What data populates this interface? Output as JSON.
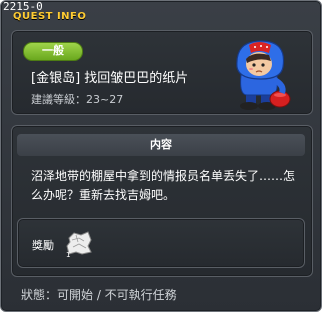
{
  "window": {
    "quest_id": "2215-0",
    "title": "QUEST INFO"
  },
  "quest": {
    "category": "一般",
    "name": "[金银岛] 找回皱巴巴的纸片",
    "level": "建議等級：23~27",
    "npc_icon": "hooded-boy-npc-icon"
  },
  "content": {
    "header": "内容",
    "description": "沼泽地带的棚屋中拿到的情报员名单丢失了……怎么办呢？重新去找吉姆吧。"
  },
  "reward": {
    "label": "獎勵",
    "item_icon": "crumpled-paper-icon"
  },
  "status": "狀態：可開始 / 不可執行任務",
  "colors": {
    "title": "#ffcc33",
    "badge": "#7ab82a"
  }
}
